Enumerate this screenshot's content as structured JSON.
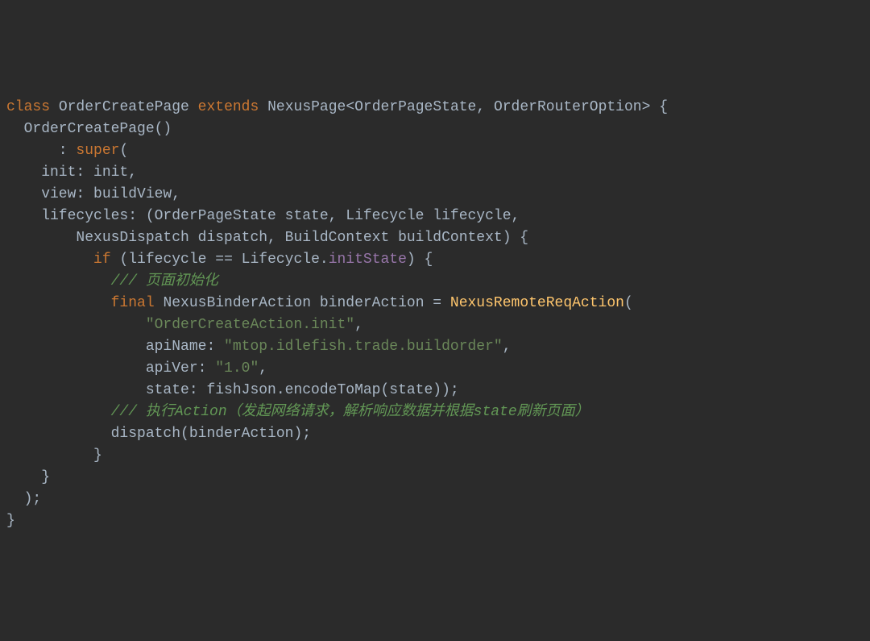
{
  "code": {
    "line1": {
      "kw_class": "class",
      "cls_name": "OrderCreatePage",
      "kw_extends": "extends",
      "parent": "NexusPage<OrderPageState, OrderRouterOption> {"
    },
    "line2": "  OrderCreatePage()",
    "line3": {
      "prefix": "      : ",
      "super": "super",
      "suffix": "("
    },
    "line4": "    init: init,",
    "line5": "    view: buildView,",
    "line6": "    lifecycles: (OrderPageState state, Lifecycle lifecycle,",
    "line7": "        NexusDispatch dispatch, BuildContext buildContext) {",
    "line8": {
      "prefix": "          ",
      "kw_if": "if",
      "mid": " (lifecycle == Lifecycle.",
      "prop": "initState",
      "suffix": ") {"
    },
    "line9": {
      "prefix": "            ",
      "comment": "/// 页面初始化"
    },
    "line10": {
      "prefix": "            ",
      "kw_final": "final",
      "mid": " NexusBinderAction binderAction = ",
      "call": "NexusRemoteReqAction",
      "suffix": "("
    },
    "line11": {
      "prefix": "                ",
      "str": "\"OrderCreateAction.init\"",
      "suffix": ","
    },
    "line12": {
      "prefix": "                apiName: ",
      "str": "\"mtop.idlefish.trade.buildorder\"",
      "suffix": ","
    },
    "line13": {
      "prefix": "                apiVer: ",
      "str": "\"1.0\"",
      "suffix": ","
    },
    "line14": "                state: fishJson.encodeToMap(state));",
    "line15": {
      "prefix": "            ",
      "comment": "/// 执行Action（发起网络请求，解析响应数据并根据state刷新页面）"
    },
    "line16": "            dispatch(binderAction);",
    "line17": "          }",
    "line18": "    }",
    "line19": "  );",
    "line20": "}"
  }
}
